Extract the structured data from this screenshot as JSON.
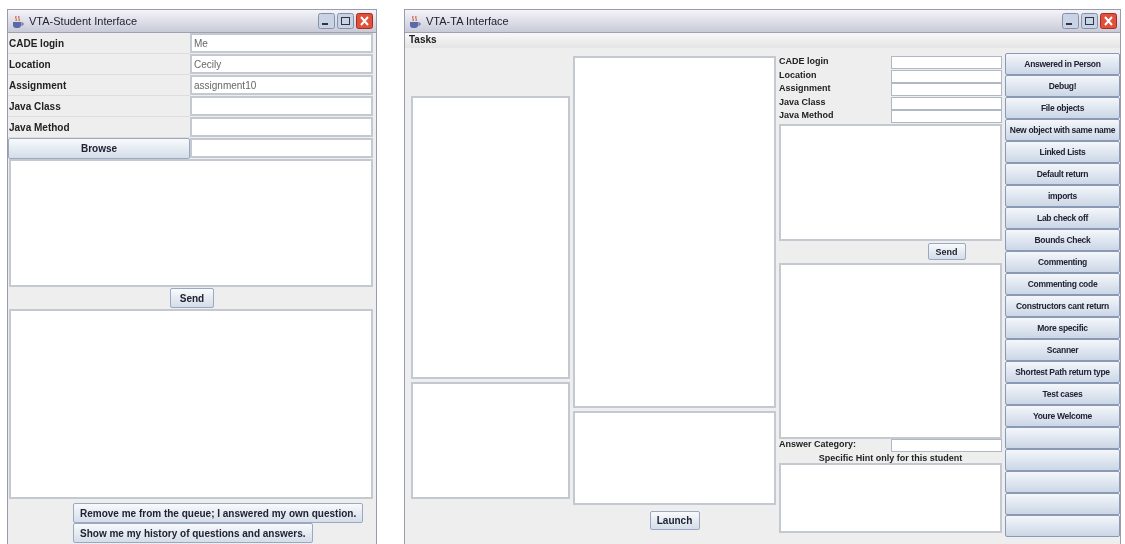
{
  "student_window": {
    "title": "VTA-Student Interface",
    "fields": [
      {
        "label": "CADE login",
        "value": "Me"
      },
      {
        "label": "Location",
        "value": "Cecily"
      },
      {
        "label": "Assignment",
        "value": "assignment10"
      },
      {
        "label": "Java Class"
      },
      {
        "label": "Java Method"
      }
    ],
    "browse_button": "Browse",
    "send_button": "Send",
    "bottom_buttons": [
      "Remove me from the queue; I answered my own question.",
      "Show me my history of questions and answers."
    ]
  },
  "ta_window": {
    "title": "VTA-TA Interface",
    "menu": [
      "Tasks"
    ],
    "fields": [
      {
        "label": "CADE login"
      },
      {
        "label": "Location"
      },
      {
        "label": "Assignment"
      },
      {
        "label": "Java Class"
      },
      {
        "label": "Java Method"
      }
    ],
    "send_button": "Send",
    "answer_category_label": "Answer Category:",
    "hint_label": "Specific Hint only for this student",
    "launch_button": "Launch",
    "category_buttons": [
      {
        "kind": "labeled",
        "label": "Answered in Person"
      },
      {
        "kind": "labeled",
        "label": "Debug!"
      },
      {
        "kind": "labeled",
        "label": "File objects"
      },
      {
        "kind": "labeled",
        "label": "New object with same name"
      },
      {
        "kind": "labeled",
        "label": "Linked Lists"
      },
      {
        "kind": "labeled",
        "label": "Default return"
      },
      {
        "kind": "labeled",
        "label": "imports"
      },
      {
        "kind": "labeled",
        "label": "Lab check off"
      },
      {
        "kind": "labeled",
        "label": "Bounds Check"
      },
      {
        "kind": "labeled",
        "label": "Commenting"
      },
      {
        "kind": "labeled",
        "label": "Commenting code"
      },
      {
        "kind": "labeled",
        "label": "Constructors cant return"
      },
      {
        "kind": "labeled",
        "label": "More specific"
      },
      {
        "kind": "labeled",
        "label": "Scanner"
      },
      {
        "kind": "labeled",
        "label": "Shortest Path return type"
      },
      {
        "kind": "labeled",
        "label": "Test cases"
      },
      {
        "kind": "labeled",
        "label": "Youre Welcome"
      },
      {
        "kind": "blank"
      },
      {
        "kind": "blank"
      },
      {
        "kind": "blank"
      },
      {
        "kind": "blank"
      },
      {
        "kind": "blank"
      }
    ]
  }
}
